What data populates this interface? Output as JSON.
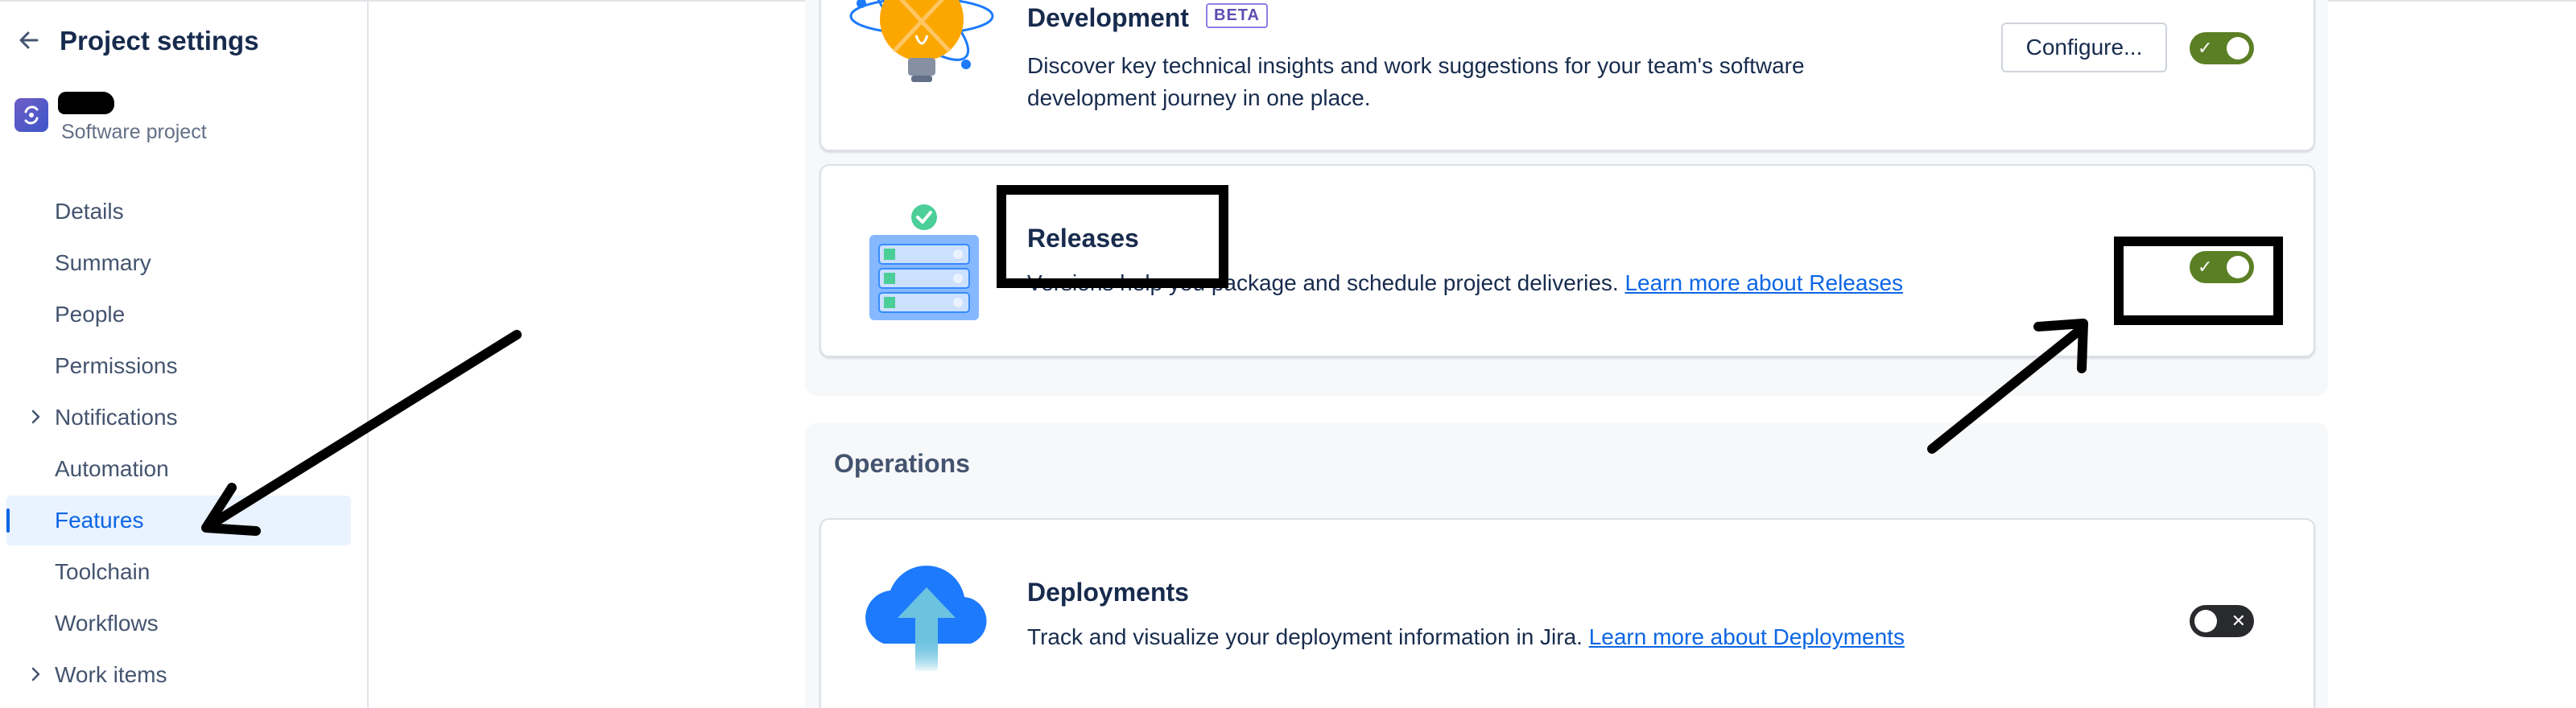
{
  "sidebar": {
    "title": "Project settings",
    "project_type": "Software project",
    "items": [
      {
        "label": "Details"
      },
      {
        "label": "Summary"
      },
      {
        "label": "People"
      },
      {
        "label": "Permissions"
      },
      {
        "label": "Notifications",
        "expandable": true
      },
      {
        "label": "Automation"
      },
      {
        "label": "Features",
        "active": true
      },
      {
        "label": "Toolchain"
      },
      {
        "label": "Workflows"
      },
      {
        "label": "Work items",
        "expandable": true
      }
    ]
  },
  "main": {
    "development": {
      "title": "Development",
      "badge": "BETA",
      "description_line1": "Discover key technical insights and work suggestions for your team's software",
      "description_line2": "development journey in one place.",
      "configure_label": "Configure...",
      "enabled": true
    },
    "releases": {
      "title": "Releases",
      "description": "Versions help you package and schedule project deliveries.",
      "link": "Learn more about Releases",
      "enabled": true
    },
    "operations": {
      "section_title": "Operations",
      "deployments": {
        "title": "Deployments",
        "description": "Track and visualize your deployment information in Jira.",
        "link": "Learn more about Deployments",
        "enabled": false
      }
    }
  },
  "toggle_marks": {
    "on": "✓",
    "off": "✕"
  },
  "colors": {
    "toggle_on": "#5b7f24",
    "toggle_off": "#292a2e",
    "active_nav": "#0c66e4",
    "link": "#0c66e4"
  }
}
